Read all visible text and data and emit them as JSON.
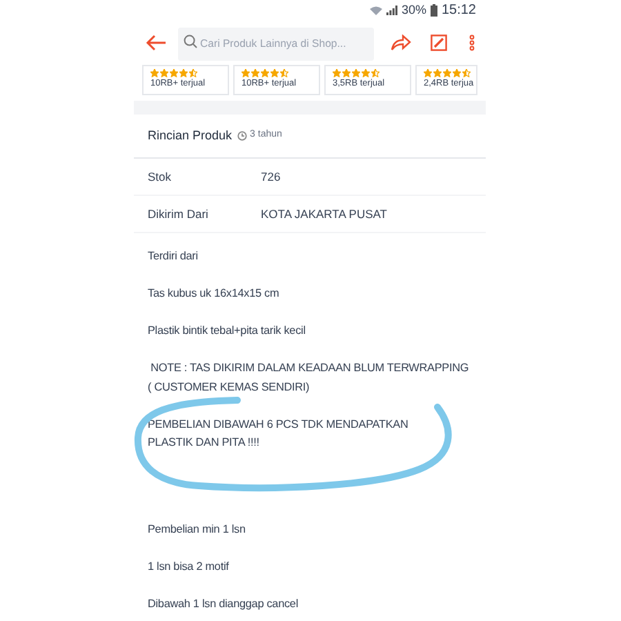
{
  "status_bar": {
    "battery": "30%",
    "time": "15:12"
  },
  "header": {
    "search": {
      "placeholder": "Cari Produk Lainnya di Shop..."
    }
  },
  "product_cards": [
    {
      "stars": 4.5,
      "sold": "10RB+ terjual"
    },
    {
      "stars": 4.5,
      "sold": "10RB+ terjual"
    },
    {
      "stars": 4.5,
      "sold": "3,5RB terjual"
    },
    {
      "stars": 4.5,
      "sold": "2,4RB terjua"
    }
  ],
  "details": {
    "title": "Rincian Produk",
    "age": "3 tahun",
    "rows": [
      {
        "label": "Stok",
        "value": "726"
      },
      {
        "label": "Dikirim Dari",
        "value": "KOTA JAKARTA PUSAT"
      }
    ]
  },
  "description": [
    {
      "lines": [
        "Terdiri dari"
      ],
      "circled": false
    },
    {
      "lines": [
        "Tas kubus uk 16x14x15 cm"
      ],
      "circled": false
    },
    {
      "lines": [
        "Plastik bintik tebal+pita tarik kecil"
      ],
      "circled": false
    },
    {
      "lines": [
        " NOTE : TAS DIKIRIM DALAM KEADAAN BLUM TERWRAPPING",
        "( CUSTOMER KEMAS SENDIRI)"
      ],
      "circled": false
    },
    {
      "lines": [
        "PEMBELIAN DIBAWAH 6 PCS TDK MENDAPATKAN",
        "PLASTIK DAN PITA !!!!"
      ],
      "circled": true
    },
    {
      "lines": [
        "Pembelian min 1 lsn"
      ],
      "circled": false
    },
    {
      "lines": [
        "1 lsn bisa 2 motif"
      ],
      "circled": false
    },
    {
      "lines": [
        "Dibawah 1 lsn dianggap cancel"
      ],
      "circled": false
    }
  ]
}
